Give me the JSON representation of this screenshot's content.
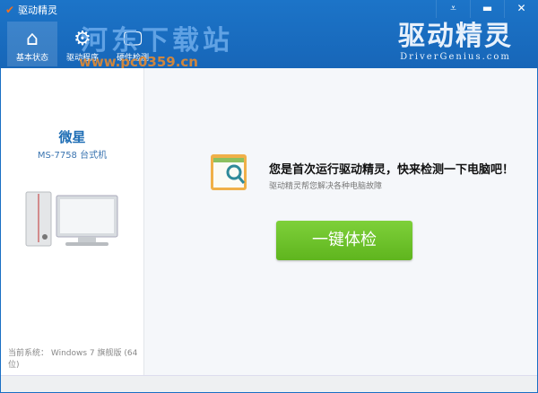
{
  "window": {
    "title": "驱动精灵",
    "menu_icon": "dropdown-icon",
    "minimize_icon": "minimize-icon",
    "close_icon": "close-icon"
  },
  "nav": [
    {
      "label": "基本状态",
      "icon": "home-icon",
      "active": true
    },
    {
      "label": "驱动程序",
      "icon": "gear-icon",
      "active": false
    },
    {
      "label": "硬件检测",
      "icon": "monitor-icon",
      "active": false
    }
  ],
  "brand": {
    "name": "驱动精灵",
    "url": "DriverGenius.com"
  },
  "watermark": {
    "title": "河东下载站",
    "url": "www.pc0359.cn"
  },
  "device": {
    "vendor": "微星",
    "model": "MS-7758 台式机"
  },
  "system": {
    "label": "当前系统：",
    "value": "Windows 7 旗舰版 (64位)"
  },
  "main": {
    "headline": "您是首次运行驱动精灵，快来检测一下电脑吧！",
    "subtext": "驱动精灵帮您解决各种电脑故障",
    "check_button": "一键体检"
  }
}
